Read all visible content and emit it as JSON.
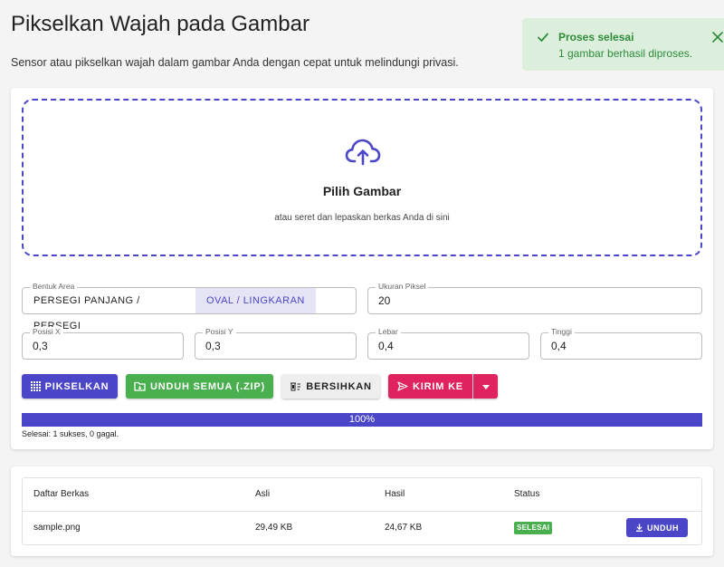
{
  "page": {
    "title": "Pikselkan Wajah pada Gambar",
    "subtitle": "Sensor atau pikselkan wajah dalam gambar Anda dengan cepat untuk melindungi privasi."
  },
  "toast": {
    "title": "Proses selesai",
    "message": "1 gambar berhasil diproses.",
    "color": "#2e8b3a",
    "icons": [
      "check-icon",
      "close-icon"
    ]
  },
  "dropzone": {
    "title": "Pilih Gambar",
    "hint": "atau seret dan lepaskan berkas Anda di sini",
    "icon": "cloud-upload-icon"
  },
  "settings": {
    "shape": {
      "label": "Bentuk Area",
      "options": [
        "PERSEGI PANJANG / PERSEGI",
        "OVAL / LINGKARAN"
      ],
      "selected": "OVAL / LINGKARAN"
    },
    "pixel_size": {
      "label": "Ukuran Piksel",
      "value": "20"
    },
    "pos_x": {
      "label": "Posisi X",
      "value": "0,3"
    },
    "pos_y": {
      "label": "Posisi Y",
      "value": "0,3"
    },
    "width": {
      "label": "Lebar",
      "value": "0,4"
    },
    "height": {
      "label": "Tinggi",
      "value": "0,4"
    }
  },
  "actions": {
    "pixelate": "PIKSELKAN",
    "download_all": "UNDUH SEMUA (.ZIP)",
    "clear": "BERSIHKAN",
    "send_to": "KIRIM KE"
  },
  "progress": {
    "percent": 100,
    "label": "100%",
    "status": "Selesai: 1 sukses, 0 gagal."
  },
  "files": {
    "headers": [
      "Daftar Berkas",
      "Asli",
      "Hasil",
      "Status"
    ],
    "rows": [
      {
        "name": "sample.png",
        "original": "29,49 KB",
        "result": "24,67 KB",
        "status": "SELESAI",
        "action": "UNDUH"
      }
    ]
  },
  "colors": {
    "primary": "#4b46c8",
    "success": "#4aaf4f",
    "accent": "#e0225f"
  }
}
